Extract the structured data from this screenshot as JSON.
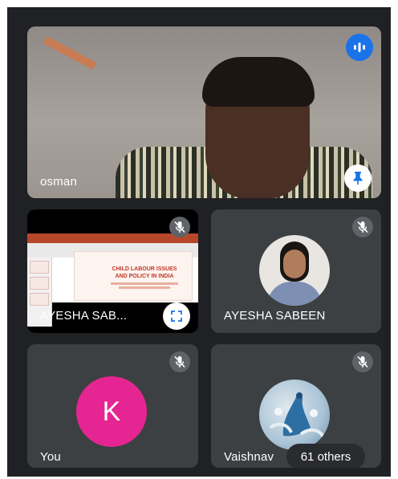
{
  "participants": {
    "main": {
      "name": "osman"
    },
    "presenter": {
      "name": "AYESHA SAB..."
    },
    "ayesha": {
      "name": "AYESHA SABEEN"
    },
    "self": {
      "name": "You",
      "initial": "K"
    },
    "vaishnavi": {
      "name": "Vaishnav"
    }
  },
  "slide": {
    "title_line1": "CHILD LABOUR ISSUES",
    "title_line2": "AND POLICY IN INDIA"
  },
  "others_badge": "61 others",
  "colors": {
    "background": "#202124",
    "tile": "#3c4043",
    "speaking_indicator": "#1a73e8",
    "self_avatar": "#e52592"
  }
}
